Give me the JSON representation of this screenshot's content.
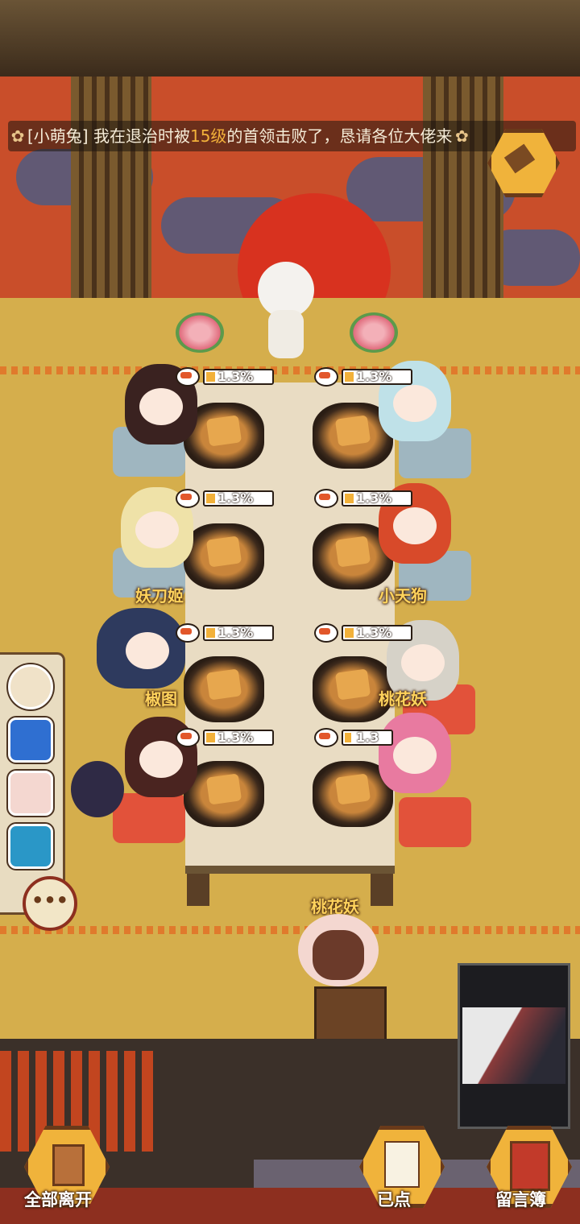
{
  "marquee": {
    "prefix": "[小萌兔] 我在退治时被",
    "level": "15级",
    "suffix": "的首领击败了，恳请各位大佬来"
  },
  "seats": [
    {
      "pct": "1.3%",
      "name": "",
      "progress": 0.13
    },
    {
      "pct": "1.3%",
      "name": "",
      "progress": 0.13
    },
    {
      "pct": "1.3%",
      "name": "妖刀姬",
      "progress": 0.13
    },
    {
      "pct": "1.3%",
      "name": "小天狗",
      "progress": 0.13
    },
    {
      "pct": "1.3%",
      "name": "椒图",
      "progress": 0.13
    },
    {
      "pct": "1.3%",
      "name": "桃花妖",
      "progress": 0.13
    },
    {
      "pct": "1.3%",
      "name": "",
      "progress": 0.13
    },
    {
      "pct": "1.3",
      "name": "",
      "progress": 0.13
    }
  ],
  "reception": {
    "name": "桃花妖"
  },
  "sidebar": {
    "more": "•••"
  },
  "buttons": {
    "leave_all": "全部离开",
    "ordered": "已点",
    "guestbook": "留言簿"
  },
  "colors": {
    "accent": "#f2b13a",
    "wall": "#c94e2a",
    "floor": "#d5ae4c",
    "name_text": "#ffd35c"
  },
  "icons": [
    "hammer-icon",
    "sushi-icon",
    "door-icon",
    "checklist-icon",
    "book-icon",
    "more-icon"
  ]
}
